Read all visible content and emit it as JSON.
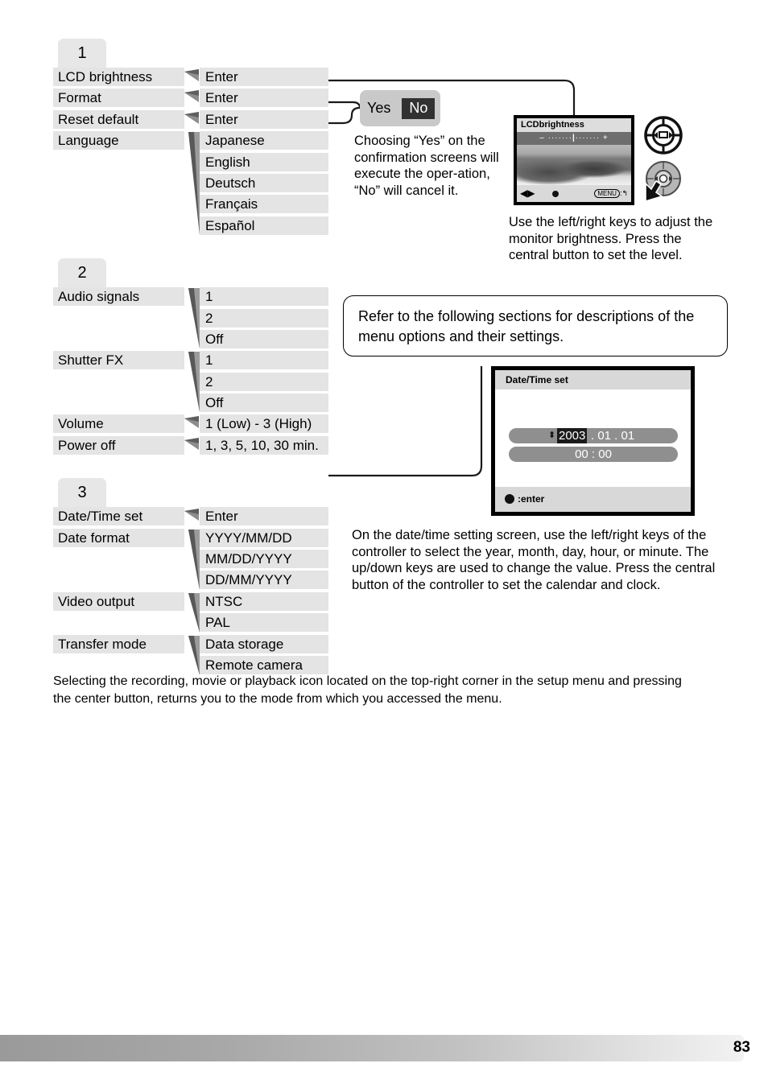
{
  "page": {
    "number": "83",
    "bottom_note": "Selecting the recording, movie or playback icon located on the top-right corner in the setup menu and pressing the center button, returns you to the mode from which you accessed the menu."
  },
  "menu_tree": {
    "sections": [
      {
        "tab": "1",
        "rows": [
          {
            "left": "LCD brightness",
            "right": "Enter",
            "connector": "short"
          },
          {
            "left": "Format",
            "right": "Enter",
            "connector": "short"
          },
          {
            "left": "Reset default",
            "right": "Enter",
            "connector": "short"
          },
          {
            "left": "Language",
            "right": "Japanese",
            "connector": "long5"
          },
          {
            "left": "",
            "right": "English",
            "connector": "none"
          },
          {
            "left": "",
            "right": "Deutsch",
            "connector": "none"
          },
          {
            "left": "",
            "right": "Français",
            "connector": "none"
          },
          {
            "left": "",
            "right": "Español",
            "connector": "none"
          }
        ]
      },
      {
        "tab": "2",
        "rows": [
          {
            "left": "Audio signals",
            "right": "1",
            "connector": "long3"
          },
          {
            "left": "",
            "right": "2",
            "connector": "none"
          },
          {
            "left": "",
            "right": "Off",
            "connector": "none"
          },
          {
            "left": "Shutter FX",
            "right": "1",
            "connector": "long3"
          },
          {
            "left": "",
            "right": "2",
            "connector": "none"
          },
          {
            "left": "",
            "right": "Off",
            "connector": "none"
          },
          {
            "left": "Volume",
            "right": "1 (Low) - 3 (High)",
            "connector": "short"
          },
          {
            "left": "Power off",
            "right": "1, 3, 5, 10, 30 min.",
            "connector": "short"
          }
        ]
      },
      {
        "tab": "3",
        "rows": [
          {
            "left": "Date/Time set",
            "right": "Enter",
            "connector": "short"
          },
          {
            "left": "Date format",
            "right": "YYYY/MM/DD",
            "connector": "long3"
          },
          {
            "left": "",
            "right": "MM/DD/YYYY",
            "connector": "none"
          },
          {
            "left": "",
            "right": "DD/MM/YYYY",
            "connector": "none"
          },
          {
            "left": "Video output",
            "right": "NTSC",
            "connector": "long2"
          },
          {
            "left": "",
            "right": "PAL",
            "connector": "none"
          },
          {
            "left": "Transfer mode",
            "right": "Data storage",
            "connector": "long2"
          },
          {
            "left": "",
            "right": "Remote camera",
            "connector": "none"
          }
        ]
      }
    ]
  },
  "confirmation": {
    "yes_label": "Yes",
    "no_label": "No",
    "description": "Choosing “Yes” on the confirmation screens will execute the oper-ation, “No” will cancel it."
  },
  "lcd_brightness_screen": {
    "title": "LCDbrightness",
    "scale_minus": "–",
    "scale_plus": "+",
    "scale_ticks": "·······",
    "menu_hint": "MENU",
    "menu_hint_suffix": ":",
    "caption": "Use the left/right keys to adjust the monitor brightness. Press the central button to set the level."
  },
  "callout": {
    "text": "Refer to the following sections for descriptions of the menu options and their settings."
  },
  "datetime_screen": {
    "title": "Date/Time set",
    "year": "2003",
    "date_rest": ".    01  .     01",
    "time": "00  :  00",
    "footer_label": ":enter",
    "caption": "On the date/time setting screen, use the left/right keys of the controller to select the year, month, day, hour, or minute. The up/down keys are used to change the value. Press the central button of the controller to set the calendar and clock."
  },
  "colors": {
    "cell_bg": "#e4e4e4",
    "tab_bg": "#e7e7e7",
    "chip_bg": "#c9c9c9",
    "selected_bg": "#313131"
  }
}
